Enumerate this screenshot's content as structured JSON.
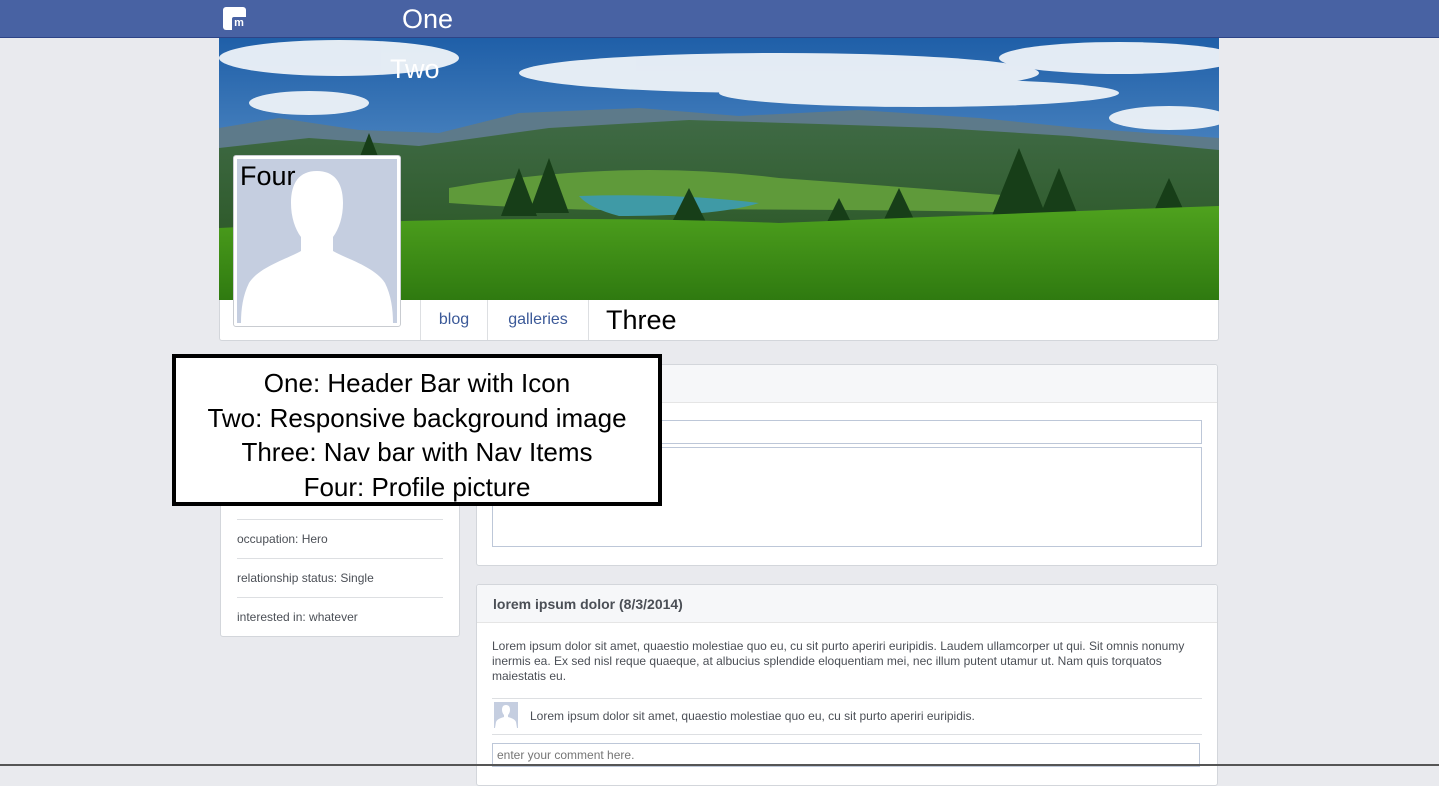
{
  "header": {
    "marker": "One"
  },
  "cover": {
    "marker": "Two"
  },
  "nav": {
    "items": [
      "blog",
      "galleries"
    ],
    "marker": "Three"
  },
  "profile": {
    "marker": "Four"
  },
  "about": {
    "rows": [
      "occupation: Hero",
      "relationship status: Single",
      "interested in: whatever"
    ]
  },
  "post": {
    "title": "lorem ipsum dolor (8/3/2014)",
    "body": "Lorem ipsum dolor sit amet, quaestio molestiae quo eu, cu sit purto aperiri euripidis. Laudem ullamcorper ut qui. Sit omnis nonumy inermis ea. Ex sed nisl reque quaeque, at albucius splendide eloquentiam mei, nec illum putent utamur ut. Nam quis torquatos maiestatis eu.",
    "comment": "Lorem ipsum dolor sit amet, quaestio molestiae quo eu, cu sit purto aperiri euripidis.",
    "comment_placeholder": "enter your comment here."
  },
  "callout": {
    "lines": [
      "One: Header Bar with Icon",
      "Two: Responsive background image",
      "Three: Nav bar with Nav Items",
      "Four: Profile picture"
    ]
  },
  "colors": {
    "header_bg": "#4862a3",
    "link": "#3b5998",
    "page_bg": "#e9eaee"
  }
}
